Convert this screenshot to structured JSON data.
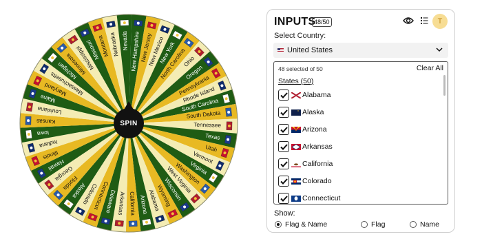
{
  "wheel": {
    "spin_label": "SPIN",
    "colors": [
      "#1f5c14",
      "#e8b923",
      "#f4ecb4"
    ],
    "states": [
      "New Hampshire",
      "New Jersey",
      "New Mexico",
      "New York",
      "North Carolina",
      "Ohio",
      "Oregon",
      "Pennsylvania",
      "Rhode Island",
      "South Carolina",
      "South Dakota",
      "Tennessee",
      "Texas",
      "Utah",
      "Vermont",
      "Virginia",
      "Washington",
      "West Virginia",
      "Wisconsin",
      "Wyoming",
      "Alabama",
      "Arizona",
      "California",
      "Arkansas",
      "Delaware",
      "Connecticut",
      "Colorado",
      "Alaska",
      "Florida",
      "Georgia",
      "Hawaii",
      "Illinois",
      "Indiana",
      "Iowa",
      "Kansas",
      "Louisiana",
      "Maine",
      "Maryland",
      "Massachusetts",
      "Michigan",
      "Minnesota",
      "Mississippi",
      "Missouri",
      "Montana",
      "Nebraska",
      "Nevada"
    ]
  },
  "panel": {
    "title": "INPUTS",
    "count_badge": "48/50",
    "avatar_initial": "T",
    "country_label": "Select Country:",
    "country_value": "United States",
    "selected_text": "48 selected of 50",
    "clear_all": "Clear All",
    "states_header": "States (50)",
    "items": [
      {
        "name": "Alabama",
        "flag": "alabama",
        "checked": true
      },
      {
        "name": "Alaska",
        "flag": "alaska",
        "checked": true
      },
      {
        "name": "Arizona",
        "flag": "arizona",
        "checked": true
      },
      {
        "name": "Arkansas",
        "flag": "arkansas",
        "checked": true
      },
      {
        "name": "California",
        "flag": "california",
        "checked": true
      },
      {
        "name": "Colorado",
        "flag": "colorado",
        "checked": true
      },
      {
        "name": "Connecticut",
        "flag": "connecticut",
        "checked": true
      }
    ],
    "show_label": "Show:",
    "show_options": [
      {
        "label": "Flag & Name",
        "selected": true
      },
      {
        "label": "Flag",
        "selected": false
      },
      {
        "label": "Name",
        "selected": false
      }
    ]
  }
}
